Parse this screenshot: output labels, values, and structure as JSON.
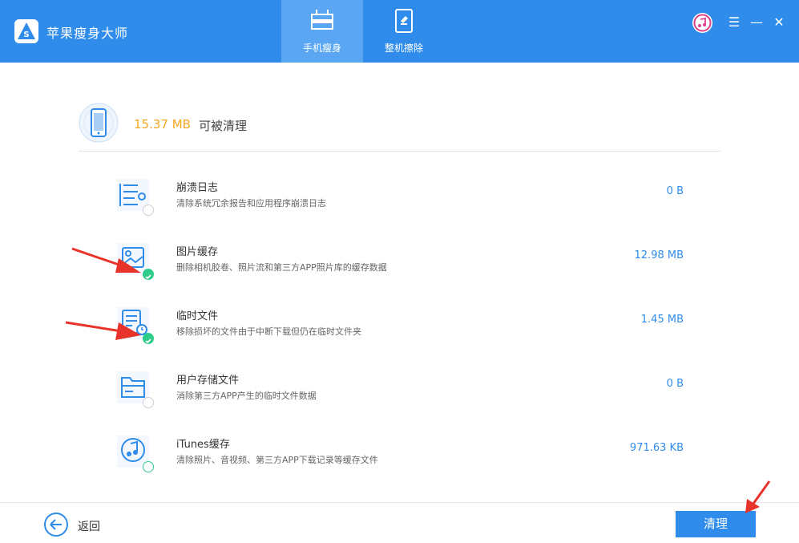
{
  "app": {
    "title": "苹果瘦身大师"
  },
  "tabs": [
    {
      "label": "手机瘦身",
      "active": true,
      "icon": "phone-slim-icon"
    },
    {
      "label": "整机擦除",
      "active": false,
      "icon": "device-erase-icon"
    }
  ],
  "window": {
    "icons": [
      "itunes-icon",
      "menu-icon",
      "minimize-icon",
      "close-icon"
    ]
  },
  "summary": {
    "size": "15.37 MB",
    "text": "可被清理"
  },
  "items": [
    {
      "title": "崩溃日志",
      "desc": "清除系统冗余报告和应用程序崩溃日志",
      "size": "0 B",
      "checked": false,
      "icon": "log-icon"
    },
    {
      "title": "图片缓存",
      "desc": "删除相机胶卷、照片流和第三方APP照片库的缓存数据",
      "size": "12.98 MB",
      "checked": true,
      "icon": "image-icon"
    },
    {
      "title": "临时文件",
      "desc": "移除损坏的文件由于中断下载但仍在临时文件夹",
      "size": "1.45 MB",
      "checked": true,
      "icon": "temp-file-icon"
    },
    {
      "title": "用户存储文件",
      "desc": "消除第三方APP产生的临时文件数据",
      "size": "0 B",
      "checked": false,
      "icon": "folder-icon"
    },
    {
      "title": "iTunes缓存",
      "desc": "清除照片、音视频、第三方APP下载记录等缓存文件",
      "size": "971.63 KB",
      "checked": false,
      "icon": "music-icon"
    }
  ],
  "footer": {
    "back_label": "返回",
    "clean_label": "清理"
  },
  "colors": {
    "brand": "#2f8cea",
    "accent": "#f5a623",
    "check": "#2ecb8b",
    "annotation": "#e8332b"
  }
}
